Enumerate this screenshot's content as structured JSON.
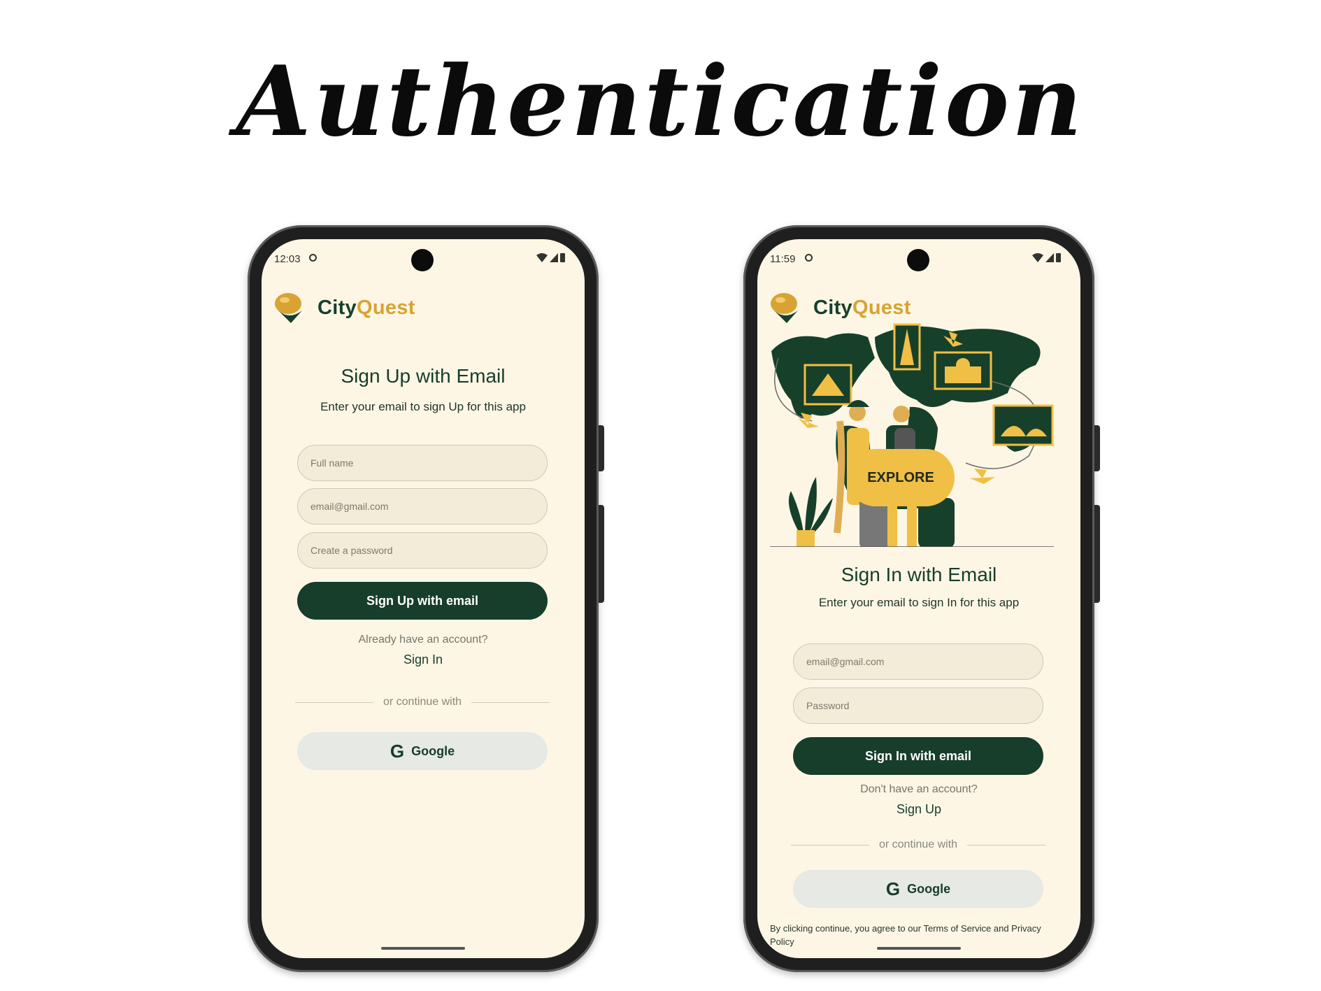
{
  "page": {
    "title": "Authentication"
  },
  "brand": {
    "city": "City",
    "quest": "Quest"
  },
  "signup": {
    "status_time": "12:03",
    "title": "Sign Up with Email",
    "subtitle": "Enter your email to sign Up for this app",
    "fullname_placeholder": "Full name",
    "email_placeholder": "email@gmail.com",
    "password_placeholder": "Create a password",
    "submit_label": "Sign Up with email",
    "have_account": "Already have an account?",
    "signin_link": "Sign In",
    "divider": "or continue with",
    "google_label": "Google"
  },
  "signin": {
    "status_time": "11:59",
    "explore_label": "EXPLORE",
    "title": "Sign In with Email",
    "subtitle": "Enter your email to sign In for this app",
    "email_placeholder": "email@gmail.com",
    "password_placeholder": "Password",
    "submit_label": "Sign In with email",
    "no_account": "Don't have an account?",
    "signup_link": "Sign Up",
    "divider": "or continue with",
    "google_label": "Google",
    "legal": "By clicking continue, you agree to our Terms of Service and Privacy Policy"
  },
  "colors": {
    "primary": "#173d2b",
    "accent": "#d8a332",
    "background": "#fdf6e5",
    "explore": "#f0bf45"
  },
  "icons": [
    "clock-icon",
    "wifi-icon",
    "signal-icon",
    "battery-icon",
    "app-logo-icon",
    "google-icon"
  ]
}
